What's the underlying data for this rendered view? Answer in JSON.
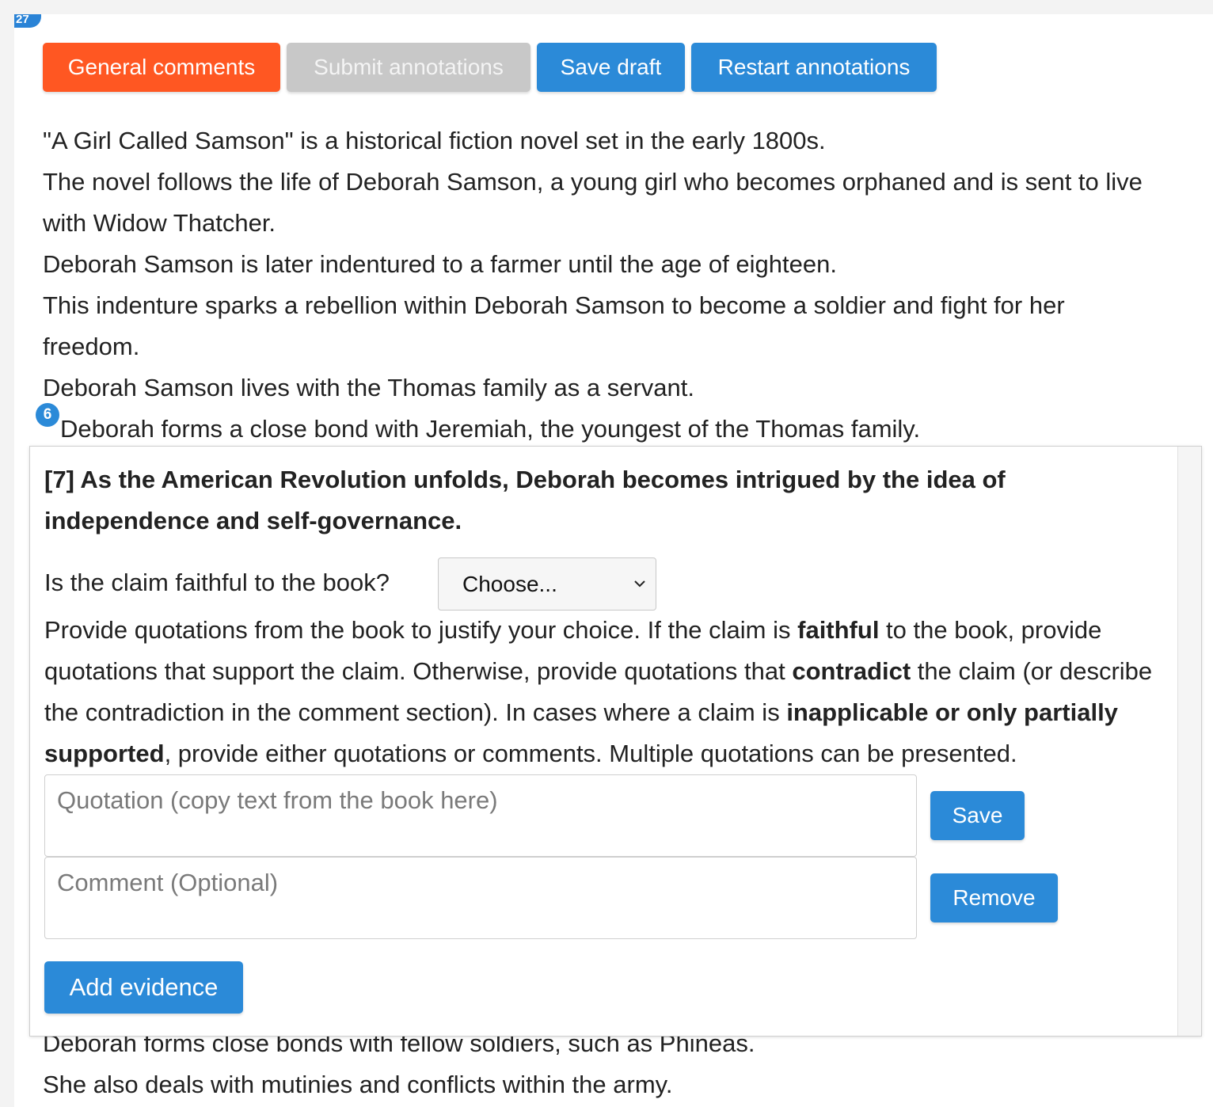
{
  "corner_badge": "27",
  "toolbar": {
    "general_comments": "General comments",
    "submit_annotations": "Submit annotations",
    "save_draft": "Save draft",
    "restart_annotations": "Restart annotations"
  },
  "summary_lines": [
    "\"A Girl Called Samson\" is a historical fiction novel set in the early 1800s.",
    "The novel follows the life of Deborah Samson, a young girl who becomes orphaned and is sent to live",
    "with Widow Thatcher.",
    "Deborah Samson is later indentured to a farmer until the age of eighteen.",
    "This indenture sparks a rebellion within Deborah Samson to become a soldier and fight for her",
    "freedom.",
    "Deborah Samson lives with the Thomas family as a servant.",
    "Deborah forms a close bond with Jeremiah, the youngest of the Thomas family."
  ],
  "claim_badge": "6",
  "claim_panel": {
    "claim_text": "[7] As the American Revolution unfolds, Deborah becomes intrigued by the idea of independence and self-governance.",
    "question": "Is the claim faithful to the book?",
    "select_value": "Choose...",
    "instructions": {
      "p1": "Provide quotations from the book to justify your choice. If the claim is ",
      "b1": "faithful",
      "p2": " to the book, provide quotations that support the claim. Otherwise, provide quotations that ",
      "b2": "contradict",
      "p3": " the claim (or describe the contradiction in the comment section). In cases where a claim is ",
      "b3": "inapplicable or only partially supported",
      "p4": ", provide either quotations or comments. Multiple quotations can be presented."
    },
    "quotation_placeholder": "Quotation (copy text from the book here)",
    "comment_placeholder": "Comment (Optional)",
    "save_label": "Save",
    "remove_label": "Remove",
    "add_evidence_label": "Add evidence"
  },
  "after_lines": [
    "Deborah forms close bonds with fellow soldiers, such as Phineas.",
    "She also deals with mutinies and conflicts within the army."
  ],
  "colors": {
    "orange": "#ff5722",
    "blue": "#2b8ad8",
    "disabled_gray": "#c8c8c8"
  }
}
